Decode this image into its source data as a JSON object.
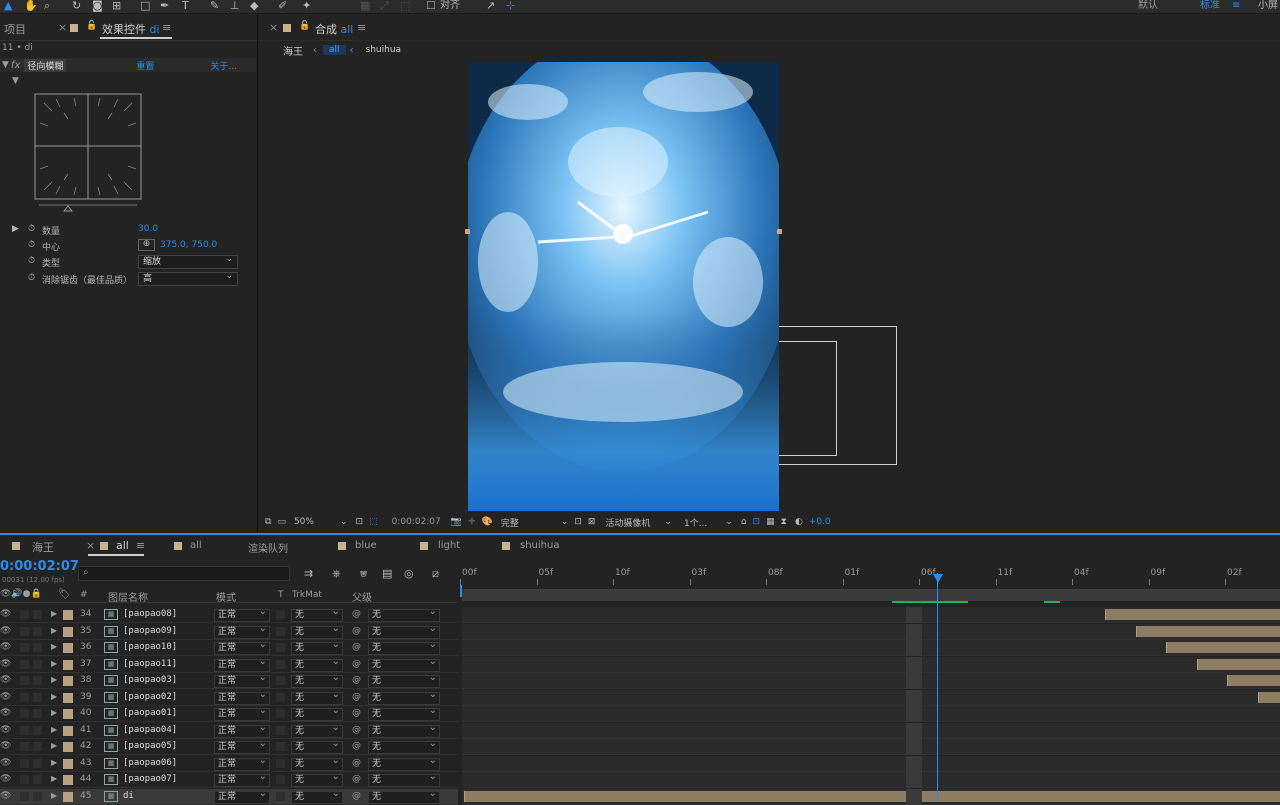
{
  "toolbar": {
    "snap_label": "对齐",
    "workspace_default": "默认",
    "workspace_standard": "标准",
    "workspace_small": "小屏",
    "menu_icon": "hamburger-icon"
  },
  "left_panel": {
    "tab_project": "项目",
    "tab_effects": "效果控件",
    "tab_effects_layer": "di",
    "layer_path": "11 • di",
    "effect_name": "径向模糊",
    "reset_label": "重置",
    "about_label": "关于...",
    "props": [
      {
        "label": "数量",
        "value": "30.0"
      },
      {
        "label": "中心",
        "value": "375.0, 750.0"
      },
      {
        "label": "类型",
        "value": "缩放"
      },
      {
        "label": "消除锯齿（最佳品质）",
        "value": "高"
      }
    ]
  },
  "viewer": {
    "tab_label": "合成",
    "tab_comp": "all",
    "breadcrumb": [
      "海王",
      "all",
      "shuihua"
    ],
    "zoom": "50%",
    "timecode": "0:00:02:07",
    "quality": "完整",
    "camera": "活动摄像机",
    "views": "1个...",
    "exposure": "+0.0"
  },
  "timeline": {
    "tabs": [
      "海王",
      "all",
      "all",
      "渲染队列",
      "blue",
      "light",
      "shuihua"
    ],
    "current_time": "0:00:02:07",
    "fps_info": "00031 (12.00 fps)",
    "search_placeholder": "",
    "col_num": "#",
    "col_name": "图层名称",
    "col_mode": "模式",
    "col_t": "T",
    "col_trkmat": "TrkMat",
    "col_parent": "父级",
    "ruler_ticks": [
      "00f",
      "05f",
      "10f",
      "03f",
      "08f",
      "01f",
      "06f",
      "11f",
      "04f",
      "09f",
      "02f"
    ],
    "layers": [
      {
        "num": "34",
        "name": "[paopao08]",
        "mode": "正常",
        "trkmat": "无",
        "parent": "无"
      },
      {
        "num": "35",
        "name": "[paopao09]",
        "mode": "正常",
        "trkmat": "无",
        "parent": "无"
      },
      {
        "num": "36",
        "name": "[paopao10]",
        "mode": "正常",
        "trkmat": "无",
        "parent": "无"
      },
      {
        "num": "37",
        "name": "[paopao11]",
        "mode": "正常",
        "trkmat": "无",
        "parent": "无"
      },
      {
        "num": "38",
        "name": "[paopao03]",
        "mode": "正常",
        "trkmat": "无",
        "parent": "无"
      },
      {
        "num": "39",
        "name": "[paopao02]",
        "mode": "正常",
        "trkmat": "无",
        "parent": "无"
      },
      {
        "num": "40",
        "name": "[paopao01]",
        "mode": "正常",
        "trkmat": "无",
        "parent": "无"
      },
      {
        "num": "41",
        "name": "[paopao04]",
        "mode": "正常",
        "trkmat": "无",
        "parent": "无"
      },
      {
        "num": "42",
        "name": "[paopao05]",
        "mode": "正常",
        "trkmat": "无",
        "parent": "无"
      },
      {
        "num": "43",
        "name": "[paopao06]",
        "mode": "正常",
        "trkmat": "无",
        "parent": "无"
      },
      {
        "num": "44",
        "name": "[paopao07]",
        "mode": "正常",
        "trkmat": "无",
        "parent": "无"
      },
      {
        "num": "45",
        "name": "di",
        "mode": "正常",
        "trkmat": "无",
        "parent": "无"
      }
    ]
  }
}
